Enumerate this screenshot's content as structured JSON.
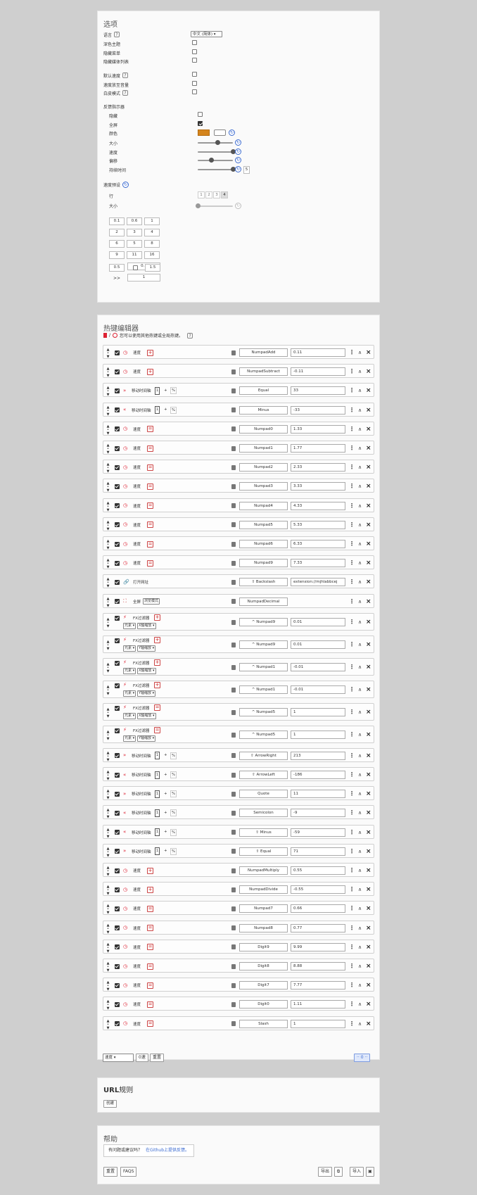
{
  "options": {
    "title": "选项",
    "rows": [
      {
        "label": "语言",
        "help": true
      },
      {
        "label": "深色主题",
        "help": false
      },
      {
        "label": "隐藏菜单",
        "help": false
      },
      {
        "label": "隐藏媒体列表",
        "help": false
      },
      {
        "label": "默认速度",
        "help": true
      },
      {
        "label": "速度放至音量",
        "help": false
      },
      {
        "label": "白皮模式",
        "help": true
      }
    ],
    "language_value": "中文 (简体) ▾",
    "indicator": {
      "title": "反馈指示器",
      "rows": [
        "隐藏",
        "全屏",
        "颜色",
        "大小",
        "速度",
        "偏移",
        "持续时间"
      ],
      "duration_value": "5"
    },
    "speed_presets": {
      "title": "速度预设",
      "row_label": "行",
      "size_label": "大小",
      "row_options": [
        "1",
        "2",
        "3",
        "4"
      ],
      "grid": [
        [
          "0.1",
          "0.6",
          "1"
        ],
        [
          "2",
          "3",
          "4"
        ],
        [
          "6",
          "5",
          "8"
        ],
        [
          "9",
          "11",
          "16"
        ]
      ],
      "inc_rows": [
        {
          "sym": ">",
          "val": "0.1"
        },
        {
          "sym": ">>",
          "val": "1"
        }
      ],
      "range_from": "0.5",
      "range_to": "1.5"
    }
  },
  "hotkeys": {
    "title": "热键编辑器",
    "note": "您可以使用其他热键或全局热键。",
    "help": "?",
    "items": [
      {
        "kind": "speed",
        "label": "速度",
        "op": "+",
        "key": "NumpadAdd",
        "value": "0.11"
      },
      {
        "kind": "speed",
        "label": "速度",
        "op": "+",
        "key": "NumpadSubtract",
        "value": "-0.11"
      },
      {
        "kind": "seek",
        "label": "移动时间轴",
        "dir": "fwd",
        "key": "Equal",
        "value": "33"
      },
      {
        "kind": "seek",
        "label": "移动时间轴",
        "dir": "back",
        "key": "Minus",
        "value": "-33"
      },
      {
        "kind": "speed",
        "label": "速度",
        "op": "=",
        "key": "Numpad0",
        "value": "1.33"
      },
      {
        "kind": "speed",
        "label": "速度",
        "op": "=",
        "key": "Numpad1",
        "value": "1.77"
      },
      {
        "kind": "speed",
        "label": "速度",
        "op": "=",
        "key": "Numpad2",
        "value": "2.33"
      },
      {
        "kind": "speed",
        "label": "速度",
        "op": "=",
        "key": "Numpad3",
        "value": "3.33"
      },
      {
        "kind": "speed",
        "label": "速度",
        "op": "=",
        "key": "Numpad4",
        "value": "4.33"
      },
      {
        "kind": "speed",
        "label": "速度",
        "op": "=",
        "key": "Numpad5",
        "value": "5.33"
      },
      {
        "kind": "speed",
        "label": "速度",
        "op": "=",
        "key": "Numpad6",
        "value": "6.33"
      },
      {
        "kind": "speed",
        "label": "速度",
        "op": "=",
        "key": "Numpad9",
        "value": "7.33"
      },
      {
        "kind": "url",
        "label": "打开网址",
        "key": "⇧ Backslash",
        "value": "extension://mjhlabbcej"
      },
      {
        "kind": "fullscreen",
        "label": "全屏",
        "extra": "浏览模式",
        "key": "NumpadDecimal",
        "value": ""
      },
      {
        "kind": "fx",
        "label": "FX过滤器",
        "op": "+",
        "sel1": "元素 ▾",
        "sel2": "X轴缩放 ▾",
        "key": "^ Numpad9",
        "value": "0.01"
      },
      {
        "kind": "fx",
        "label": "FX过滤器",
        "op": "+",
        "sel1": "元素 ▾",
        "sel2": "Y轴缩放 ▾",
        "key": "^ Numpad9",
        "value": "0.01"
      },
      {
        "kind": "fx",
        "label": "FX过滤器",
        "op": "+",
        "sel1": "元素 ▾",
        "sel2": "X轴缩放 ▾",
        "key": "^ Numpad1",
        "value": "-0.01"
      },
      {
        "kind": "fx",
        "label": "FX过滤器",
        "op": "+",
        "sel1": "元素 ▾",
        "sel2": "Y轴缩放 ▾",
        "key": "^ Numpad1",
        "value": "-0.01"
      },
      {
        "kind": "fx",
        "label": "FX过滤器",
        "op": "=",
        "sel1": "元素 ▾",
        "sel2": "X轴缩放 ▾",
        "key": "^ Numpad5",
        "value": "1"
      },
      {
        "kind": "fx",
        "label": "FX过滤器",
        "op": "=",
        "sel1": "元素 ▾",
        "sel2": "Y轴缩放 ▾",
        "key": "^ Numpad5",
        "value": "1"
      },
      {
        "kind": "seek",
        "label": "移动时间轴",
        "dir": "fwd",
        "key": "⇧ ArrowRight",
        "value": "213"
      },
      {
        "kind": "seek",
        "label": "移动时间轴",
        "dir": "back",
        "key": "⇧ ArrowLeft",
        "value": "-186"
      },
      {
        "kind": "seek",
        "label": "移动时间轴",
        "dir": "fwd",
        "key": "Quote",
        "value": "11"
      },
      {
        "kind": "seek",
        "label": "移动时间轴",
        "dir": "back",
        "key": "Semicolon",
        "value": "-9"
      },
      {
        "kind": "seek",
        "label": "移动时间轴",
        "dir": "back",
        "key": "⇧ Minus",
        "value": "-59"
      },
      {
        "kind": "seek",
        "label": "移动时间轴",
        "dir": "fwd",
        "key": "⇧ Equal",
        "value": "71"
      },
      {
        "kind": "speed",
        "label": "速度",
        "op": "+",
        "key": "NumpadMultiply",
        "value": "0.55"
      },
      {
        "kind": "speed",
        "label": "速度",
        "op": "+",
        "key": "NumpadDivide",
        "value": "-0.55"
      },
      {
        "kind": "speed",
        "label": "速度",
        "op": "=",
        "key": "Numpad7",
        "value": "0.66"
      },
      {
        "kind": "speed",
        "label": "速度",
        "op": "=",
        "key": "Numpad8",
        "value": "0.77"
      },
      {
        "kind": "speed",
        "label": "速度",
        "op": "=",
        "key": "Digit9",
        "value": "9.99"
      },
      {
        "kind": "speed",
        "label": "速度",
        "op": "=",
        "key": "Digit8",
        "value": "8.88"
      },
      {
        "kind": "speed",
        "label": "速度",
        "op": "=",
        "key": "Digit7",
        "value": "7.77"
      },
      {
        "kind": "speed",
        "label": "速度",
        "op": "=",
        "key": "Digit0",
        "value": "1.11"
      },
      {
        "kind": "speed",
        "label": "速度",
        "op": "=",
        "key": "Slash",
        "value": "1"
      }
    ],
    "seek_box": "1",
    "seek_plus": "+",
    "seek_pct": "%",
    "add_select": "速度 ▾",
    "reset_zero": "0速",
    "reset_label": "重置",
    "more_button": "·· 0 ··"
  },
  "url_rules": {
    "title_bold": "URL",
    "title_rest": "规则",
    "button": "创建"
  },
  "help_panel": {
    "title": "帮助",
    "note_prefix": "有问题或建议吗？",
    "note_link": "在Github上提供反馈。",
    "reset": "重置",
    "faqs": "FAQS",
    "export": "导出",
    "import": "导入"
  },
  "colors": {
    "accent": "#d4841c",
    "red": "#d23",
    "blue": "#3a6ad0"
  }
}
